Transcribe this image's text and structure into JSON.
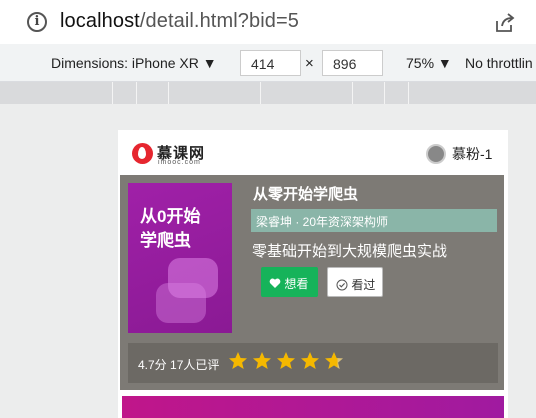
{
  "browser": {
    "url_host": "localhost",
    "url_path": "/detail.html?bid=5"
  },
  "devtools": {
    "dimensions_label": "Dimensions: iPhone XR ▼",
    "width": "414",
    "times": "×",
    "height": "896",
    "zoom": "75% ▼",
    "throttling": "No throttlin"
  },
  "header": {
    "logo_text": "慕课网",
    "logo_sub": "imooc.com",
    "username": "慕粉-1"
  },
  "book": {
    "cover_text": "从0开始\n学爬虫",
    "title": "从零开始学爬虫",
    "teacher": "梁睿坤 · 20年资深架构师",
    "subtitle": "零基础开始到大规模爬虫实战",
    "want_label": "想看",
    "seen_label": "看过",
    "rating_text": "4.7分 17人已评",
    "rating_stars": 4.7
  },
  "colors": {
    "accent_green": "#16b35a",
    "teacher_band": "#8ab5a8",
    "star": "#f5b800"
  }
}
